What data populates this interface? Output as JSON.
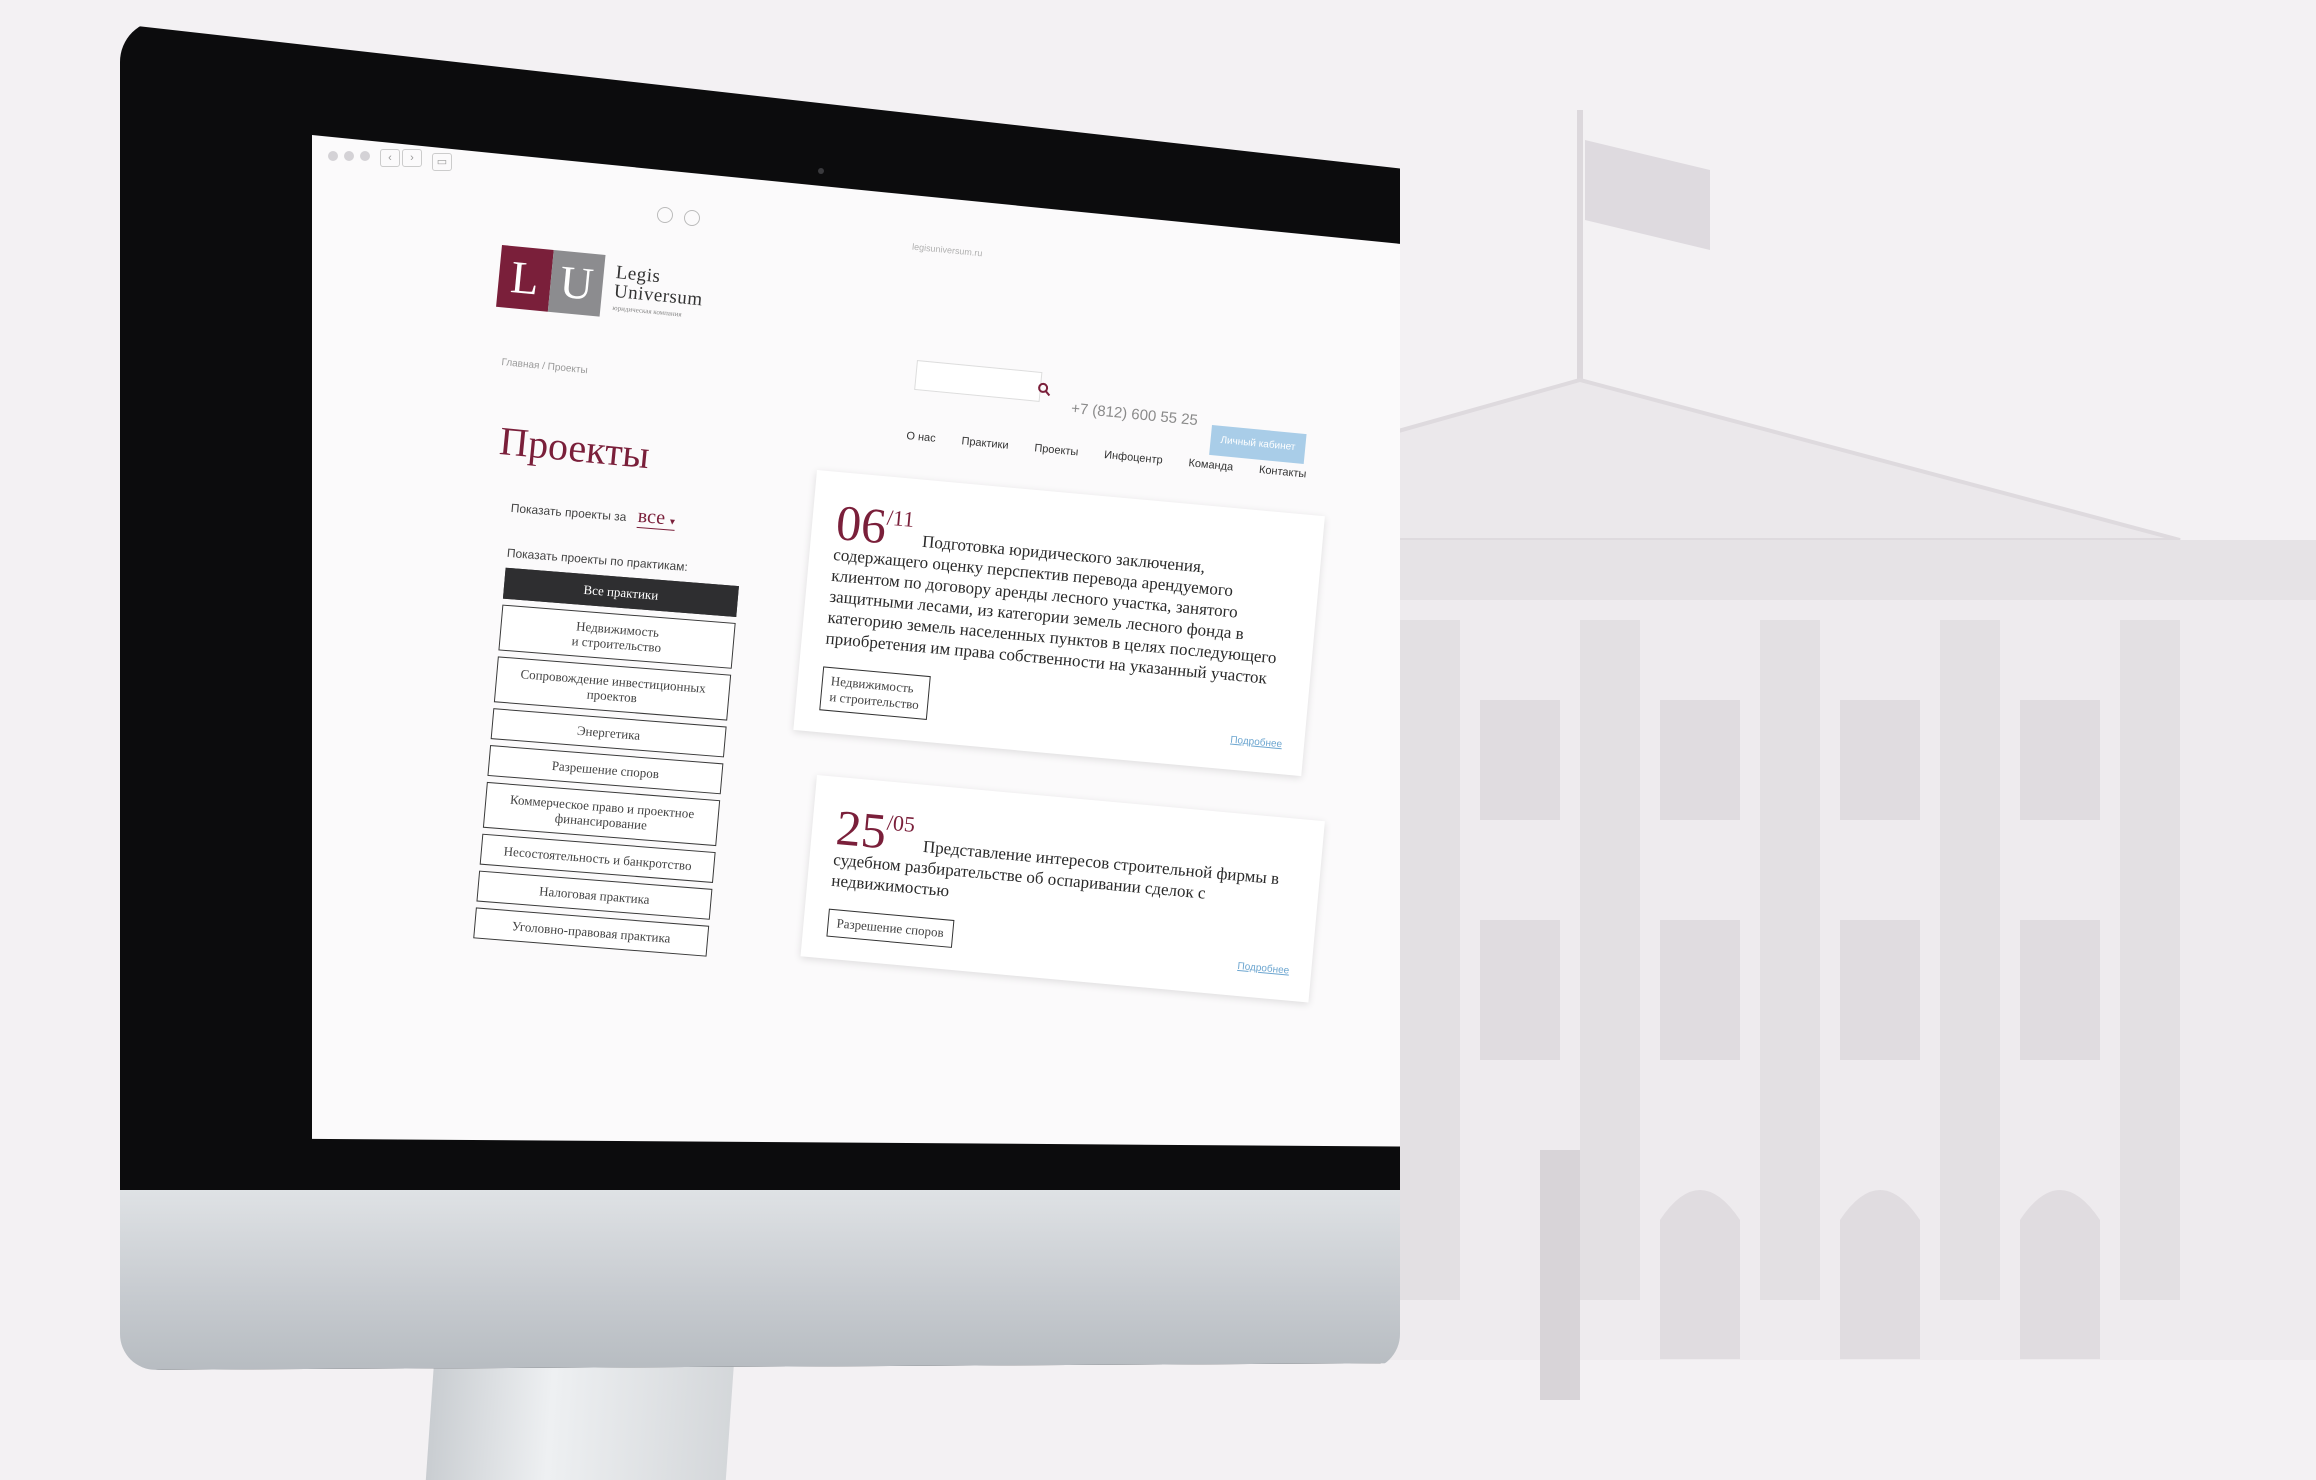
{
  "site": {
    "url": "legisuniversum.ru",
    "logo": {
      "letters_left": "L",
      "letters_right": "U",
      "line1": "Legis",
      "line2": "Universum",
      "tagline": "юридическая компания"
    },
    "search_placeholder": "",
    "phone": "+7 (812) 600 55 25",
    "cabinet_button": "Личный кабинет",
    "nav": [
      "О нас",
      "Практики",
      "Проекты",
      "Инфоцентр",
      "Команда",
      "Контакты"
    ],
    "breadcrumb": "Главная / Проекты",
    "page_title": "Проекты"
  },
  "filter": {
    "period_label": "Показать проекты за",
    "period_value": "все",
    "practices_label": "Показать проекты по практикам:",
    "practices": [
      "Все практики",
      "Недвижимость\nи строительство",
      "Сопровождение инвестиционных проектов",
      "Энергетика",
      "Разрешение споров",
      "Коммерческое право и проектное финансирование",
      "Несостоятельность и банкротство",
      "Налоговая практика",
      "Уголовно-правовая практика"
    ]
  },
  "projects": [
    {
      "day": "06",
      "month": "/11",
      "description": "Подготовка юридического заключения, содержащего оценку перспектив перевода арендуемого клиентом по договору аренды лесного участка, занятого защитными лесами, из категории земель лесного фонда в категорию земель населенных пунктов в целях последующего приобретения им права собственности на указанный участок",
      "tag": "Недвижимость\nи строительство",
      "more": "Подробнее"
    },
    {
      "day": "25",
      "month": "/05",
      "description": "Представление интересов строительной фирмы в судебном разбирательстве об оспаривании сделок с недвижимостью",
      "tag": "Разрешение споров",
      "more": "Подробнее"
    }
  ],
  "colors": {
    "brand": "#7a1f3a",
    "button_blue": "#a9cde8",
    "link_blue": "#6da6d0"
  }
}
